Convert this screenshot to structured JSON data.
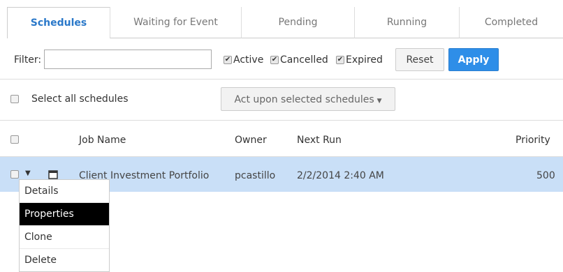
{
  "tabs": [
    {
      "label": "Schedules",
      "active": true
    },
    {
      "label": "Waiting for Event"
    },
    {
      "label": "Pending"
    },
    {
      "label": "Running"
    },
    {
      "label": "Completed"
    }
  ],
  "filter": {
    "label": "Filter:",
    "value": "",
    "options": [
      {
        "label": "Active",
        "checked": true
      },
      {
        "label": "Cancelled",
        "checked": true
      },
      {
        "label": "Expired",
        "checked": true
      }
    ],
    "reset_label": "Reset",
    "apply_label": "Apply"
  },
  "select_all_label": "Select all schedules",
  "act_label": "Act upon selected schedules",
  "table": {
    "headers": [
      "Job Name",
      "Owner",
      "Next Run",
      "Priority"
    ],
    "rows": [
      {
        "job_name": "Client Investment Portfolio",
        "owner": "pcastillo",
        "next_run": "2/2/2014 2:40 AM",
        "priority": "500"
      }
    ]
  },
  "menu": [
    "Details",
    "Properties",
    "Clone",
    "Delete"
  ],
  "colors": {
    "accent": "#2e8ee8",
    "selected_row": "#c9dff7"
  }
}
